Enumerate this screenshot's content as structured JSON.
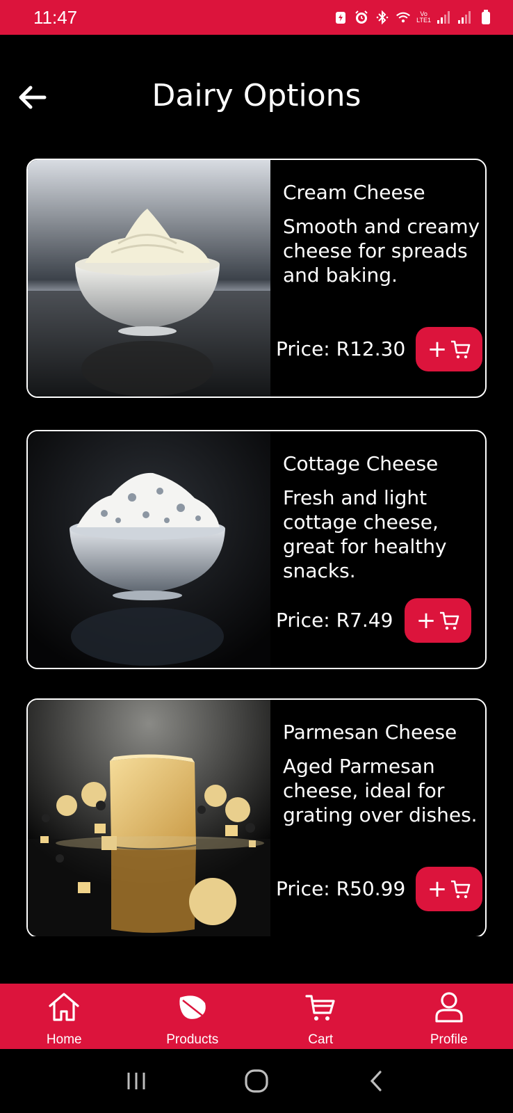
{
  "status_bar": {
    "time": "11:47",
    "volte_label_1": "Vo",
    "volte_label_2": "LTE1",
    "icons": [
      "battery-saver-icon",
      "alarm-icon",
      "bluetooth-icon",
      "wifi-icon",
      "signal-icon",
      "signal-icon",
      "battery-icon"
    ]
  },
  "header": {
    "title": "Dairy Options",
    "back_icon": "arrow-left-icon"
  },
  "products": [
    {
      "name": "Cream Cheese",
      "description": "Smooth and creamy cheese for spreads and baking.",
      "price": "Price: R12.30",
      "add_label": "+",
      "image": "cream-cheese-bowl"
    },
    {
      "name": "Cottage Cheese",
      "description": "Fresh and light cottage cheese, great for healthy snacks.",
      "price": "Price: R7.49",
      "add_label": "+",
      "image": "cottage-cheese-bowl"
    },
    {
      "name": "Parmesan Cheese",
      "description": "Aged Parmesan cheese, ideal for grating over dishes.",
      "price": "Price: R50.99",
      "add_label": "+",
      "image": "parmesan-block"
    }
  ],
  "bottom_nav": [
    {
      "label": "Home",
      "icon": "home-icon"
    },
    {
      "label": "Products",
      "icon": "leaf-icon"
    },
    {
      "label": "Cart",
      "icon": "cart-icon"
    },
    {
      "label": "Profile",
      "icon": "user-icon"
    }
  ],
  "system_nav": [
    "recents-icon",
    "home-circle-icon",
    "back-chevron-icon"
  ],
  "colors": {
    "accent": "#dc143c",
    "background": "#000000",
    "text": "#ffffff"
  }
}
